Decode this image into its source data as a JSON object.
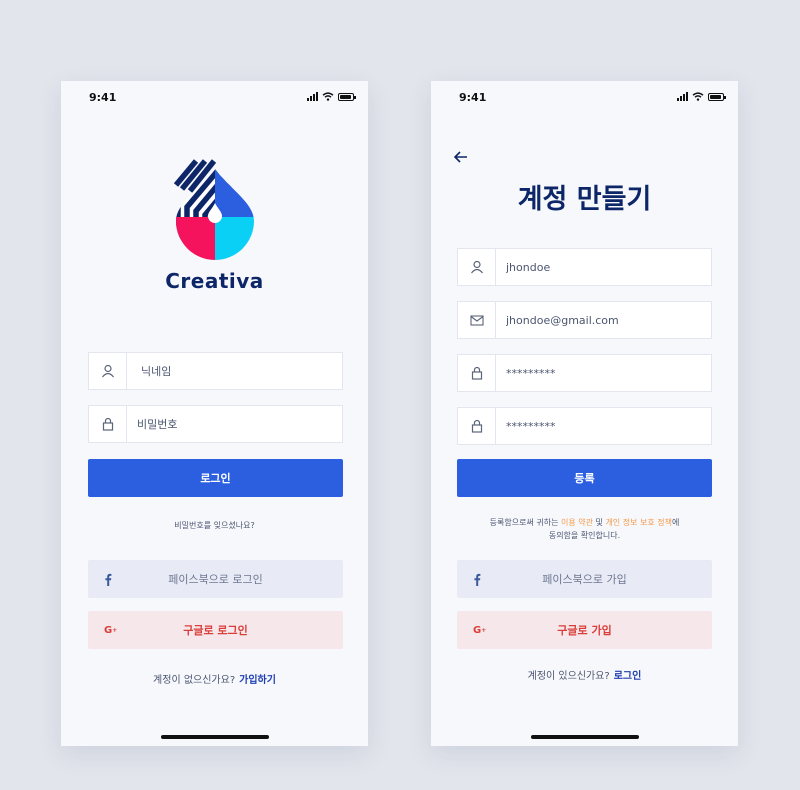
{
  "login": {
    "status_time": "9:41",
    "brand": "Creativa",
    "nickname_placeholder": "닉네임",
    "password_placeholder": "비밀번호",
    "login_button": "로그인",
    "forgot_password": "비밀번호를 잊으셨나요?",
    "facebook_button": "페이스북으로 로그인",
    "google_button": "구글로 로그인",
    "footer_text": "계정이  없으신가요?",
    "footer_link": "가입하기"
  },
  "signup": {
    "status_time": "9:41",
    "title": "계정 만들기",
    "username_value": "jhondoe",
    "email_value": "jhondoe@gmail.com",
    "password_value": "*********",
    "confirm_password_value": "*********",
    "register_button": "등록",
    "terms_prefix": "등록함으로써 귀하는 ",
    "terms_link": "이용 약관",
    "terms_and": " 및 ",
    "privacy_link": "개인 정보 보호 정책",
    "terms_suffix_1": "에",
    "terms_suffix_2": "동의함을 확인합니다.",
    "facebook_button": "페이스북으로 가입",
    "google_button": "구글로 가입",
    "footer_text": "계정이 있으신가요?",
    "footer_link": "로그인"
  },
  "icons": {
    "user": "user-icon",
    "lock": "lock-icon",
    "mail": "mail-icon",
    "facebook": "facebook-icon",
    "google": "google-plus-icon",
    "back": "arrow-left-icon"
  },
  "colors": {
    "primary": "#2c5fe0",
    "brand_navy": "#0d2668",
    "google_red": "#d93e3a",
    "link_orange": "#f29a4a",
    "logo_pink": "#f5135e",
    "logo_cyan": "#0bd0f5"
  }
}
